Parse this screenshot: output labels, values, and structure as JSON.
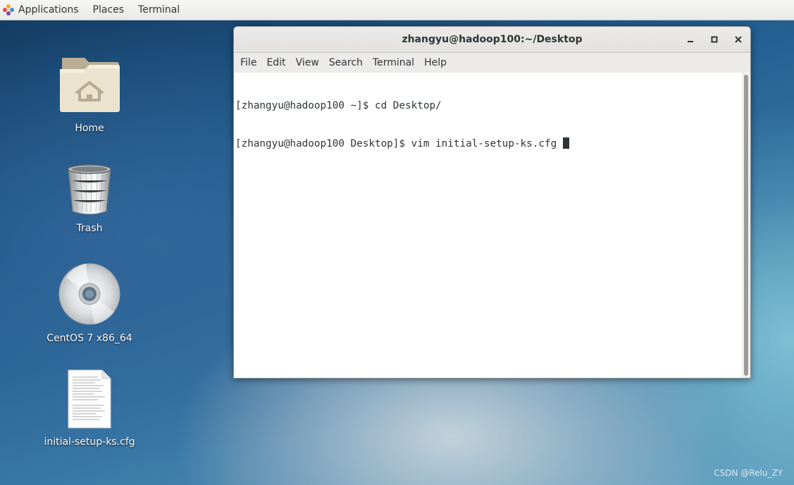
{
  "topbar": {
    "applications": "Applications",
    "places": "Places",
    "terminal": "Terminal"
  },
  "desktop": {
    "icons": [
      {
        "label": "Home",
        "icon": "folder-home-icon"
      },
      {
        "label": "Trash",
        "icon": "trash-icon"
      },
      {
        "label": "CentOS 7 x86_64",
        "icon": "optical-disc-icon"
      },
      {
        "label": "initial-setup-ks.cfg",
        "icon": "text-file-icon"
      }
    ]
  },
  "window": {
    "title": "zhangyu@hadoop100:~/Desktop",
    "menu": [
      "File",
      "Edit",
      "View",
      "Search",
      "Terminal",
      "Help"
    ],
    "terminal_lines": [
      "[zhangyu@hadoop100 ~]$ cd Desktop/",
      "[zhangyu@hadoop100 Desktop]$ vim initial-setup-ks.cfg"
    ]
  },
  "watermark": "CSDN @Relu_ZY",
  "colors": {
    "topbar_bg": "#ededeb",
    "titlebar_bg": "#e6e5e3",
    "terminal_fg": "#2e3436",
    "terminal_bg": "#ffffff"
  }
}
